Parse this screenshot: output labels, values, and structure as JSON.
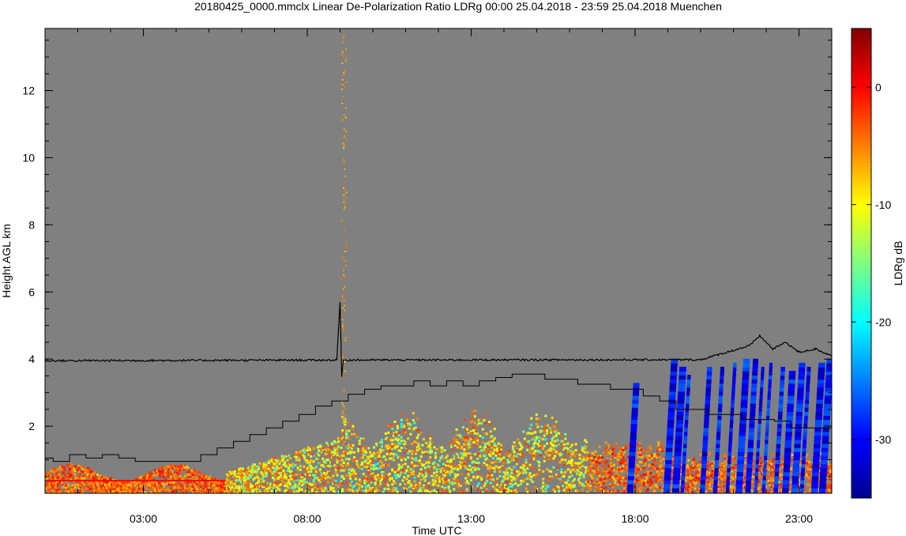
{
  "chart_data": {
    "type": "heatmap",
    "title": "20180425_0000.mmclx Linear De-Polarization Ratio LDRg   00:00 25.04.2018 - 23:59 25.04.2018 Muenchen",
    "xlabel": "Time UTC",
    "ylabel": "Height AGL km",
    "colorbar_label": "LDRg dB",
    "xlim": [
      0,
      24
    ],
    "ylim": [
      0,
      13.85
    ],
    "x_ticks": [
      {
        "value": 3,
        "label": "03:00"
      },
      {
        "value": 8,
        "label": "08:00"
      },
      {
        "value": 13,
        "label": "13:00"
      },
      {
        "value": 18,
        "label": "18:00"
      },
      {
        "value": 23,
        "label": "23:00"
      }
    ],
    "y_ticks": [
      {
        "value": 2,
        "label": "2"
      },
      {
        "value": 4,
        "label": "4"
      },
      {
        "value": 6,
        "label": "6"
      },
      {
        "value": 8,
        "label": "8"
      },
      {
        "value": 10,
        "label": "10"
      },
      {
        "value": 12,
        "label": "12"
      }
    ],
    "colorbar": {
      "range": [
        -35,
        5
      ],
      "ticks": [
        {
          "value": 0,
          "label": "0"
        },
        {
          "value": -10,
          "label": "-10"
        },
        {
          "value": -20,
          "label": "-20"
        },
        {
          "value": -30,
          "label": "-30"
        }
      ],
      "colormap": "jet"
    },
    "background_color": "#808080",
    "line_freezing_level": {
      "x": [
        0,
        8.9,
        9.0,
        9.05,
        9.1,
        20,
        21.5,
        21.8,
        22.2,
        22.6,
        23,
        23.5,
        24
      ],
      "y": [
        3.95,
        3.97,
        5.7,
        3.5,
        3.97,
        3.98,
        4.4,
        4.7,
        4.3,
        4.5,
        4.2,
        4.3,
        4.1
      ]
    },
    "line_step": {
      "x": [
        0,
        0.25,
        0.75,
        1.25,
        1.75,
        2.25,
        2.75,
        4.75,
        5.25,
        5.75,
        6.25,
        6.75,
        7.25,
        7.75,
        8.25,
        8.75,
        9.25,
        9.75,
        10.25,
        11.25,
        11.75,
        12.25,
        12.75,
        13.25,
        13.75,
        14.25,
        15.25,
        16.25,
        17.25,
        18.25,
        18.75,
        19.25,
        20.25,
        21.25,
        22.25,
        22.75,
        24
      ],
      "y": [
        1.05,
        0.95,
        1.15,
        1.05,
        1.15,
        1.05,
        0.95,
        1.15,
        1.35,
        1.55,
        1.75,
        1.95,
        2.15,
        2.35,
        2.6,
        2.75,
        2.95,
        3.1,
        3.2,
        3.35,
        3.2,
        3.35,
        3.2,
        3.35,
        3.45,
        3.55,
        3.4,
        3.25,
        3.1,
        2.9,
        2.75,
        2.5,
        2.35,
        2.2,
        2.15,
        1.95,
        1.95
      ]
    }
  }
}
